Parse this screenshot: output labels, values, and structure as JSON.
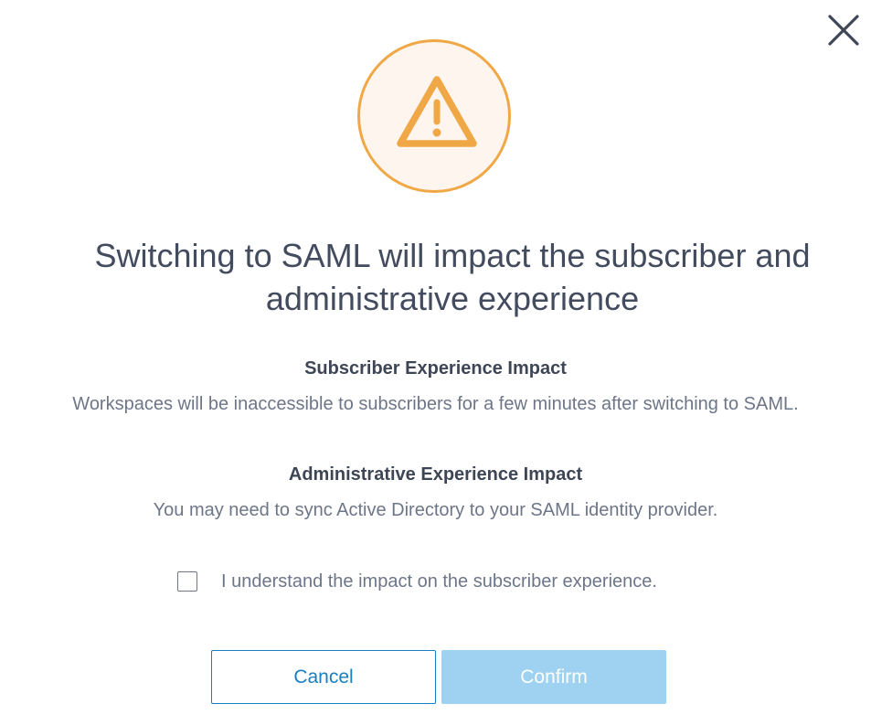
{
  "dialog": {
    "close_icon": "close-icon",
    "warning_icon": "warning-triangle-icon",
    "title": "Switching to SAML will impact the subscriber and administrative experience",
    "subscriber_heading": "Subscriber Experience Impact",
    "subscriber_text": "Workspaces will be inaccessible to subscribers for a few minutes after switching to SAML.",
    "admin_heading": "Administrative Experience Impact",
    "admin_text": "You may need to sync Active Directory to your SAML identity provider.",
    "acknowledge_label": "I understand the impact on the subscriber experience.",
    "acknowledge_checked": false,
    "cancel_label": "Cancel",
    "confirm_label": "Confirm",
    "confirm_enabled": false
  },
  "colors": {
    "warning_orange": "#f0a846",
    "warning_bg": "#fdf5ee",
    "primary_blue": "#1a7fc1",
    "disabled_blue": "#9fd2f0",
    "title_text": "#434b5e",
    "body_text": "#6d7688"
  }
}
